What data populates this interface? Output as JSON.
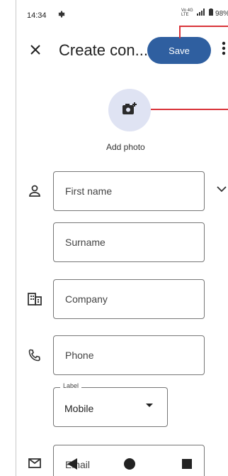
{
  "status_bar": {
    "time": "14:34",
    "gear_icon": "gear",
    "network_top": "Vo 4G",
    "network_bottom": "LTE",
    "battery": "98%"
  },
  "toolbar": {
    "title": "Create con...",
    "save_label": "Save",
    "close_icon": "close",
    "more_icon": "more-vertical"
  },
  "photo": {
    "label": "Add photo",
    "icon": "add-photo"
  },
  "fields": {
    "first_name_placeholder": "First name",
    "surname_placeholder": "Surname",
    "company_placeholder": "Company",
    "phone_placeholder": "Phone",
    "label_caption": "Label",
    "label_value": "Mobile",
    "email_placeholder": "Email"
  },
  "colors": {
    "save_bg": "#2f5fa0",
    "avatar_bg": "#dfe3f3",
    "annotation": "#d9343a"
  }
}
